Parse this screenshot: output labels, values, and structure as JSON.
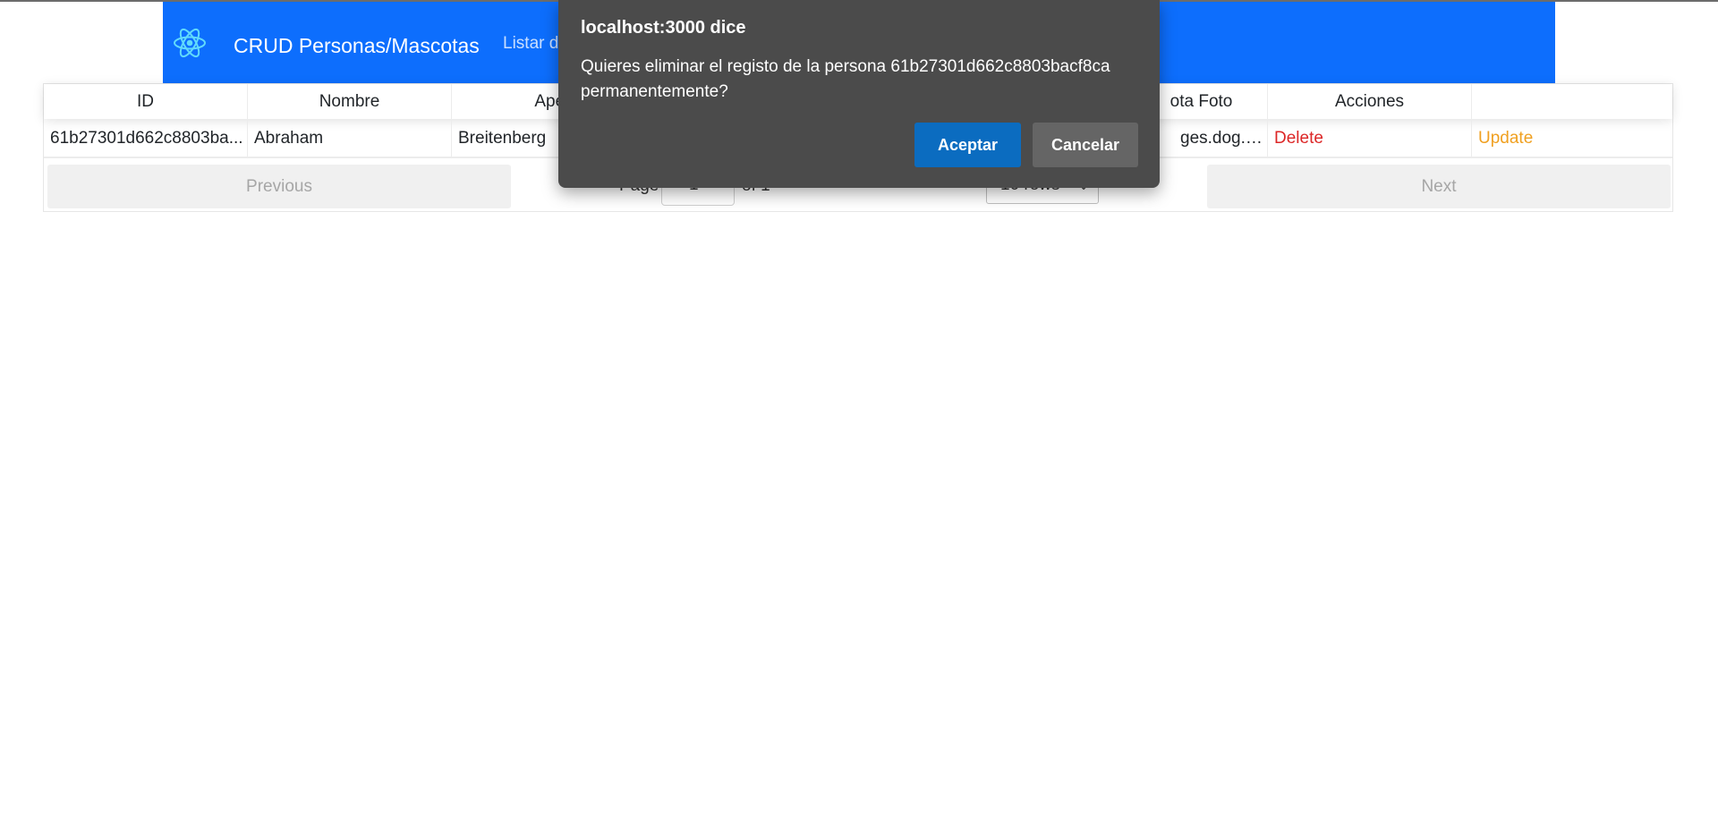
{
  "navbar": {
    "brand": "CRUD Personas/Mascotas",
    "link_partial": "Listar d",
    "logo_icon": "react-logo-icon",
    "accent_color": "#0d6efd"
  },
  "table": {
    "headers": [
      "ID",
      "Nombre",
      "Apell",
      "",
      "",
      "ota Foto",
      "Acciones",
      ""
    ],
    "row": {
      "id": "61b27301d662c8803ba...",
      "nombre": "Abraham",
      "apellido": "Breitenberg",
      "foto": "ges.dog.ceo...",
      "delete": "Delete",
      "update": "Update"
    }
  },
  "pagination": {
    "previous": "Previous",
    "next": "Next",
    "page_label": "Page",
    "page_value": "1",
    "of_label": "of 1",
    "rows_select": "10 rows"
  },
  "dialog": {
    "title": "localhost:3000 dice",
    "message": "Quieres eliminar el registo de la persona 61b27301d662c8803bacf8ca permanentemente?",
    "ok_label": "Aceptar",
    "cancel_label": "Cancelar"
  }
}
